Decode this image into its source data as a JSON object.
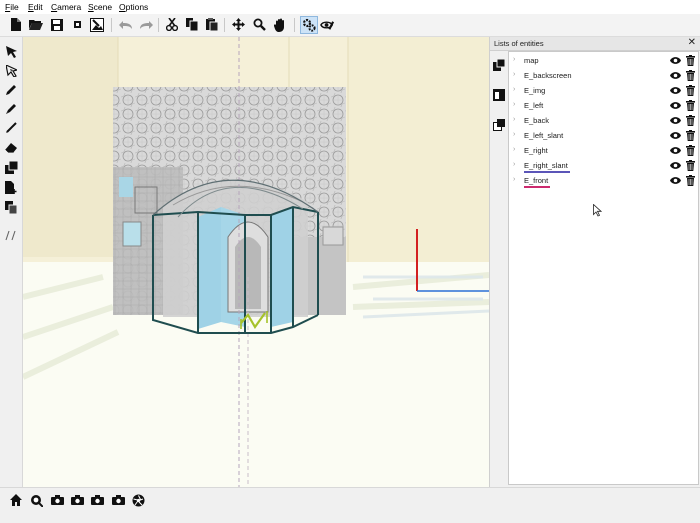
{
  "menu": {
    "items": [
      "File",
      "Edit",
      "Camera",
      "Scene",
      "Options"
    ]
  },
  "toolbar": {
    "buttons": [
      "new-file-icon",
      "open-folder-icon",
      "save-icon",
      "small-square-icon",
      "export-image-icon",
      "undo-icon",
      "redo-icon",
      "cut-icon",
      "copy-icon",
      "paste-icon",
      "move-icon",
      "zoom-icon",
      "pan-hand-icon",
      "settings-gear-icon",
      "view-eye-icon"
    ],
    "active": [
      "settings-gear-icon"
    ]
  },
  "left_tools": [
    "select-arrow-icon",
    "direct-select-icon",
    "pencil-icon",
    "brush-icon",
    "line-icon",
    "eraser-icon",
    "layers-icon",
    "add-page-icon",
    "duplicate-icon",
    "scribble-icon"
  ],
  "panel": {
    "title": "Lists of entities",
    "close": "✕",
    "side_icons": [
      "external-link-icon",
      "window-icon",
      "popout-icon"
    ],
    "entities": [
      {
        "name": "map"
      },
      {
        "name": "E_backscreen"
      },
      {
        "name": "E_img"
      },
      {
        "name": "E_left"
      },
      {
        "name": "E_back"
      },
      {
        "name": "E_left_slant"
      },
      {
        "name": "E_right"
      },
      {
        "name": "E_right_slant",
        "underline": "#5b55b8"
      },
      {
        "name": "E_front",
        "underline": "#cc2a6e"
      }
    ]
  },
  "bottom_bar": [
    "home-icon",
    "camera-search-icon",
    "camera-icon",
    "camera-icon",
    "camera-icon",
    "camera-icon",
    "aperture-icon"
  ],
  "colors": {
    "viewport_bg": "#fafbef",
    "wall": "#f5f0d8",
    "frame": "#1f4d4f",
    "axis_red": "#d32020",
    "axis_blue": "#2a6fd6",
    "light_blue": "#9fd2e6"
  }
}
